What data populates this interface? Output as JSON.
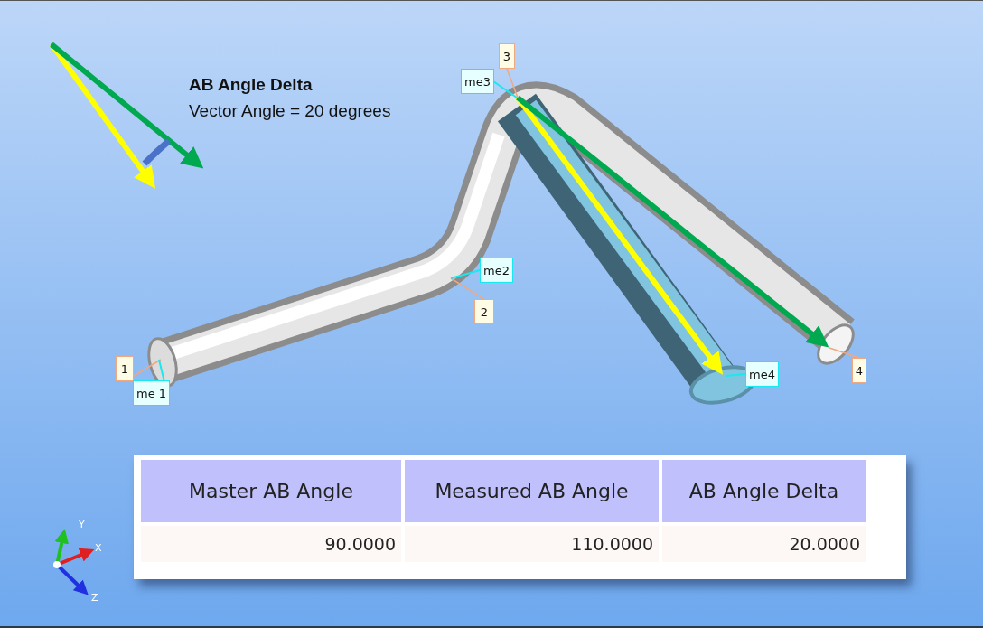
{
  "annotation": {
    "title": "AB Angle Delta",
    "subtitle": "Vector Angle = 20 degrees"
  },
  "point_labels": [
    {
      "text": "1"
    },
    {
      "text": "2"
    },
    {
      "text": "3"
    },
    {
      "text": "4"
    }
  ],
  "measure_labels": [
    {
      "text": "me 1"
    },
    {
      "text": "me2"
    },
    {
      "text": "me3"
    },
    {
      "text": "me4"
    }
  ],
  "axis_labels": [
    "X",
    "Y",
    "Z"
  ],
  "table": {
    "columns": [
      "Master AB Angle",
      "Measured AB Angle",
      "AB Angle Delta"
    ],
    "rows": [
      [
        "90.0000",
        "110.0000",
        "20.0000"
      ]
    ]
  }
}
